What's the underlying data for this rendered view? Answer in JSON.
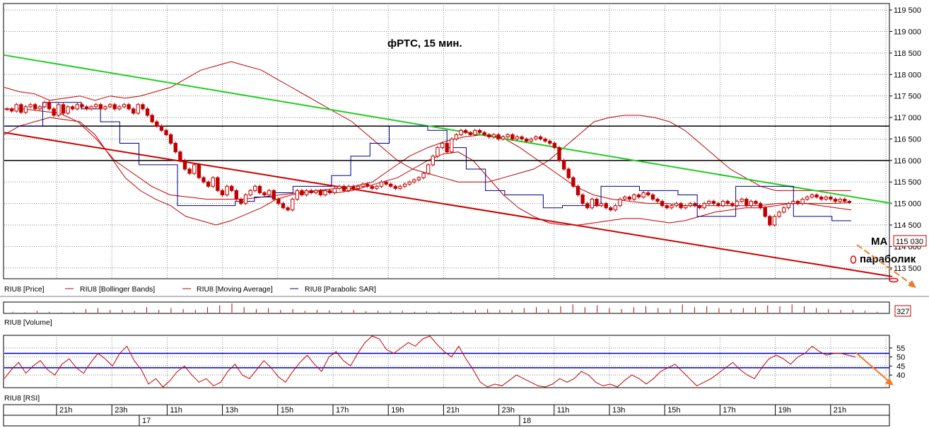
{
  "chart_data": [
    {
      "type": "candlestick",
      "title": "фРТС, 15 мин.",
      "ylim": [
        113250,
        119650
      ],
      "yticks": [
        119500,
        119000,
        118500,
        118000,
        117500,
        117000,
        116500,
        116000,
        115500,
        115000,
        114500,
        114000,
        113500
      ],
      "ytick_labels": [
        "119 500",
        "119 000",
        "118 500",
        "118 000",
        "117 500",
        "117 000",
        "116 500",
        "116 000",
        "115 500",
        "115 000",
        "114 500",
        "114 000",
        "113 500"
      ],
      "last_price_label": "115 030",
      "horizontal_levels": [
        116800,
        116000
      ],
      "trendlines": [
        {
          "color": "#22cc22",
          "from": [
            0,
            118450
          ],
          "to": [
            241,
            115000
          ]
        },
        {
          "color": "#cc0000",
          "from": [
            0,
            116650
          ],
          "to": [
            241,
            113300
          ]
        }
      ],
      "annotations": [
        "MA",
        "параболик"
      ],
      "legend": [
        "RIU8 [Price]",
        "RIU8 [Bollinger Bands]",
        "RIU8 [Moving Average]",
        "RIU8 [Parabolic SAR]"
      ],
      "series": [
        {
          "name": "RIU8 [Price]",
          "close": [
            117200,
            117150,
            117300,
            117120,
            117250,
            117300,
            117200,
            117250,
            117350,
            117200,
            117050,
            117300,
            117100,
            117250,
            117200,
            117300,
            117250,
            117200,
            117250,
            117300,
            117200,
            117250,
            117300,
            117200,
            117250,
            117300,
            117200,
            117100,
            117300,
            117200,
            117050,
            116900,
            116800,
            116700,
            116600,
            116400,
            116200,
            116000,
            115800,
            115700,
            115900,
            115600,
            115500,
            115400,
            115600,
            115300,
            115200,
            115400,
            115300,
            115100,
            115000,
            115200,
            115300,
            115400,
            115250,
            115200,
            115300,
            115100,
            115000,
            114900,
            114850,
            115100,
            115300,
            115200,
            115300,
            115250,
            115300,
            115200,
            115300,
            115250,
            115350,
            115400,
            115300,
            115400,
            115350,
            115400,
            115450,
            115400,
            115350,
            115400,
            115500,
            115450,
            115400,
            115350,
            115400,
            115450,
            115500,
            115550,
            115600,
            115700,
            115900,
            116100,
            116300,
            116400,
            116200,
            116500,
            116600,
            116700,
            116650,
            116600,
            116700,
            116650,
            116600,
            116550,
            116600,
            116500,
            116550,
            116600,
            116500,
            116550,
            116500,
            116450,
            116500,
            116550,
            116500,
            116450,
            116400,
            116300,
            116000,
            115800,
            115600,
            115400,
            115200,
            115000,
            114900,
            115100,
            114950,
            115000,
            114900,
            114850,
            114950,
            115100,
            115150,
            115100,
            115200,
            115150,
            115250,
            115200,
            115100,
            115050,
            114950,
            114900,
            114950,
            115000,
            114900,
            114950,
            115000,
            114950,
            114900,
            115000,
            115050,
            115000,
            114950,
            115050,
            115000,
            114950,
            115050,
            115100,
            114950,
            115050,
            115000,
            114900,
            114700,
            114500,
            114700,
            114800,
            114900,
            115000,
            115050,
            115000,
            115100,
            115150,
            115200,
            115150,
            115100,
            115150,
            115100,
            115050,
            115100,
            115050,
            115030
          ]
        },
        {
          "name": "RIU8 [Bollinger Bands]",
          "upper": [
            117700,
            117600,
            117550,
            117400,
            117450,
            117500,
            117400,
            117500,
            117450,
            117500,
            117600,
            117700,
            117900,
            118100,
            118200,
            118300,
            118200,
            118100,
            117900,
            117700,
            117500,
            117300,
            117100,
            116900,
            116600,
            116300,
            116000,
            115800,
            115700,
            115600,
            115500,
            115500,
            115500,
            115600,
            115700,
            115800,
            116000,
            116300,
            116600,
            116900,
            117000,
            117050,
            117050,
            117000,
            116900,
            116700,
            116400,
            116100,
            115800,
            115600,
            115400,
            115300,
            115300,
            115300,
            115300,
            115300,
            115300
          ],
          "lower": [
            116600,
            116800,
            116900,
            117000,
            116950,
            116900,
            116600,
            116100,
            115600,
            115300,
            115100,
            114950,
            114700,
            114600,
            114500,
            114600,
            114750,
            114900,
            115100,
            115200,
            115250,
            115300,
            115250,
            115300,
            115400,
            115500,
            115600,
            115800,
            116000,
            116150,
            116200,
            116000,
            115600,
            115200,
            114900,
            114700,
            114550,
            114500,
            114500,
            114550,
            114600,
            114650,
            114650,
            114600,
            114550,
            114600,
            114700,
            114800,
            114850,
            114900,
            114900,
            114950,
            115000,
            115000,
            114950,
            114900,
            114850
          ]
        },
        {
          "name": "RIU8 [Moving Average]",
          "values": [
            117200,
            117200,
            117150,
            117100,
            116900,
            116500,
            116000,
            115700,
            115400,
            115200,
            115150,
            115100,
            115100,
            115100,
            115150,
            115200,
            115250,
            115300,
            115350,
            115400,
            115500,
            115800,
            116100,
            116300,
            116450,
            116550,
            116600,
            116550,
            116300,
            116000,
            115700,
            115400,
            115200,
            115100,
            115050,
            115000,
            115000,
            114950,
            114950,
            114950,
            114950,
            114950,
            115000,
            115000,
            115000,
            115000,
            115020
          ]
        },
        {
          "name": "RIU8 [Parabolic SAR]",
          "values": [
            116800,
            116800,
            117350,
            117350,
            117200,
            116900,
            116400,
            115900,
            115900,
            114950,
            114950,
            114950,
            115050,
            115150,
            115250,
            115400,
            115400,
            115650,
            116100,
            116400,
            116800,
            116800,
            116700,
            116300,
            115800,
            115300,
            115200,
            115200,
            114900,
            114950,
            114950,
            115400,
            115400,
            115300,
            115300,
            115200,
            114700,
            114700,
            115400,
            115400,
            115400,
            114700,
            114700,
            114600,
            114600
          ]
        }
      ],
      "x_time_labels": [
        "21h",
        "23h",
        "11h",
        "13h",
        "15h",
        "17h",
        "19h",
        "21h",
        "23h",
        "11h",
        "13h",
        "15h",
        "17h",
        "19h",
        "21h"
      ],
      "x_date_labels": [
        "17",
        "18"
      ]
    },
    {
      "type": "bar",
      "legend": "RIU8 [Volume]",
      "last_value_label": "327",
      "values": [
        0.1,
        0.05,
        0.2,
        0.1,
        0.05,
        0.1,
        0.4,
        0.5,
        0.3,
        0.3,
        0.2,
        0.6,
        0.3,
        0.5,
        0.4,
        0.3,
        0.6,
        0.8,
        1.0,
        0.6,
        0.4,
        0.5,
        0.3,
        0.4,
        0.2,
        0.3,
        0.25,
        0.2,
        0.3,
        0.15,
        0.2,
        0.15,
        0.2,
        0.1,
        0.15,
        0.1,
        0.1,
        0.15,
        0.3,
        0.4,
        0.3,
        0.3,
        0.5,
        0.6,
        0.4,
        0.7,
        0.9,
        0.6,
        0.8,
        0.5,
        0.4,
        0.6,
        0.7,
        0.5,
        0.4,
        0.9,
        0.6,
        0.7,
        0.5,
        0.4,
        0.5,
        0.6,
        0.8,
        0.7,
        0.9,
        0.7,
        0.5,
        0.4,
        0.3,
        0.3,
        0.2,
        0.1
      ]
    },
    {
      "type": "line",
      "legend": "RIU8 [RSI]",
      "ylim": [
        33,
        62
      ],
      "yticks": [
        55,
        50,
        45,
        40
      ],
      "horizontal_levels": [
        52,
        44
      ],
      "values": [
        38,
        43,
        47,
        41,
        45,
        48,
        43,
        40,
        46,
        49,
        44,
        41,
        47,
        52,
        49,
        45,
        52,
        56,
        48,
        43,
        35,
        38,
        33,
        37,
        42,
        45,
        40,
        36,
        38,
        34,
        36,
        42,
        46,
        40,
        38,
        43,
        48,
        44,
        39,
        36,
        42,
        47,
        51,
        46,
        42,
        50,
        53,
        48,
        45,
        52,
        58,
        62,
        60,
        54,
        52,
        55,
        58,
        56,
        60,
        62,
        57,
        53,
        50,
        56,
        49,
        43,
        36,
        33,
        35,
        34,
        37,
        40,
        38,
        36,
        34,
        33,
        35,
        38,
        36,
        38,
        42,
        40,
        36,
        34,
        35,
        33,
        37,
        40,
        38,
        35,
        38,
        42,
        44,
        46,
        42,
        38,
        34,
        36,
        38,
        41,
        44,
        47,
        43,
        40,
        38,
        44,
        49,
        51,
        49,
        46,
        50,
        52,
        56,
        53,
        51,
        52,
        52,
        51,
        50
      ]
    }
  ]
}
